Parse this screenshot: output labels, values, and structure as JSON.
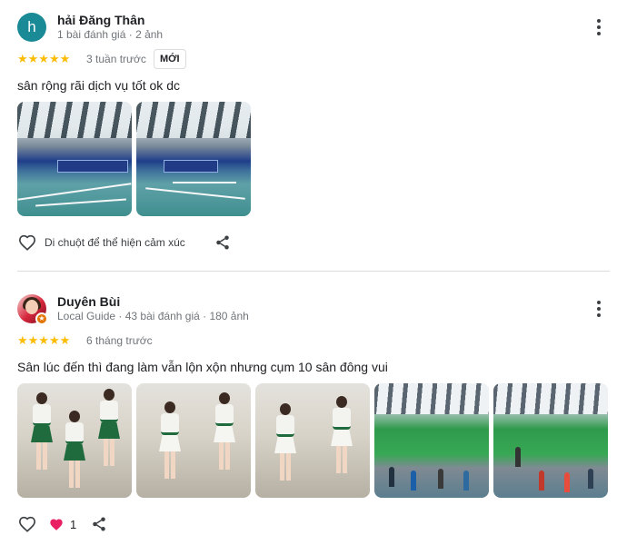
{
  "reviews": [
    {
      "avatar_letter": "h",
      "name": "hải Đăng Thân",
      "meta": "1 bài đánh giá · 2 ảnh",
      "stars": "★★★★★",
      "rating": 5,
      "time": "3 tuần trước",
      "badge": "MỚI",
      "text": "sân rộng rãi dịch vụ tốt ok dc",
      "photo_count": 2,
      "react_hint": "Di chuột để thể hiện cảm xúc",
      "icons": [
        "heart-outline-icon",
        "share-icon",
        "more-vert-icon"
      ]
    },
    {
      "name": "Duyên Bùi",
      "meta": "Local Guide · 43 bài đánh giá · 180 ảnh",
      "stars": "★★★★★",
      "rating": 5,
      "time": "6 tháng trước",
      "text": "Sân lúc đến thì đang làm vẫn lộn xộn nhưng cụm 10 sân đông vui",
      "photo_count": 5,
      "likes": "1",
      "icons": [
        "heart-outline-icon",
        "heart-filled-icon",
        "share-icon",
        "more-vert-icon",
        "local-guide-star-icon"
      ]
    }
  ],
  "colors": {
    "star": "#fbbc04",
    "avatar_h": "#1a8a96",
    "like_heart": "#e91e63",
    "divider": "#dadce0",
    "local_guide_badge": "#e37400"
  }
}
